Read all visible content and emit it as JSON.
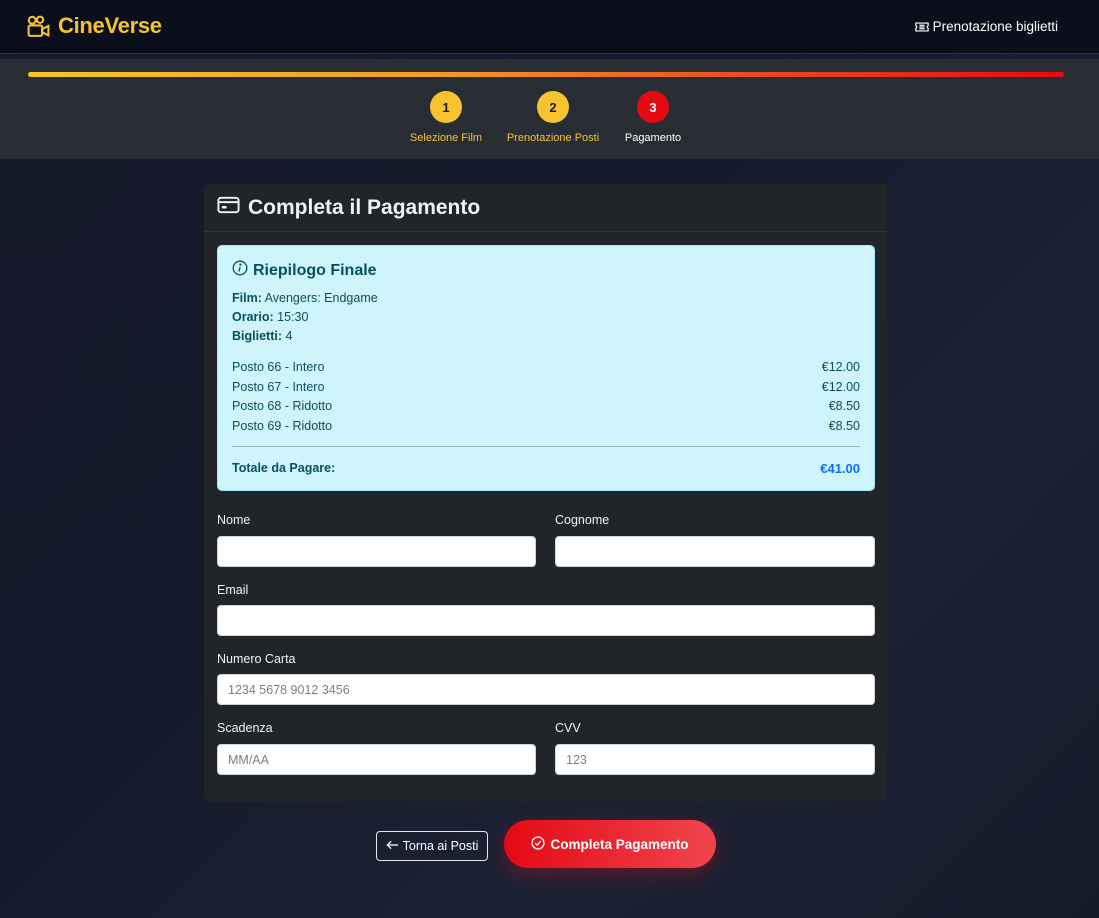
{
  "navbar": {
    "brand": "CineVerse",
    "link_label": "Prenotazione biglietti"
  },
  "stepper": {
    "steps": [
      {
        "number": "1",
        "label": "Selezione Film",
        "state": "done"
      },
      {
        "number": "2",
        "label": "Prenotazione Posti",
        "state": "done"
      },
      {
        "number": "3",
        "label": "Pagamento",
        "state": "active"
      }
    ]
  },
  "card": {
    "title": "Completa il Pagamento"
  },
  "summary": {
    "title": "Riepilogo Finale",
    "film_label": "Film:",
    "film_value": "Avengers: Endgame",
    "time_label": "Orario:",
    "time_value": "15:30",
    "tickets_label": "Biglietti:",
    "tickets_value": "4",
    "seats": [
      {
        "label": "Posto 66 - Intero",
        "price": "€12.00"
      },
      {
        "label": "Posto 67 - Intero",
        "price": "€12.00"
      },
      {
        "label": "Posto 68 - Ridotto",
        "price": "€8.50"
      },
      {
        "label": "Posto 69 - Ridotto",
        "price": "€8.50"
      }
    ],
    "total_label": "Totale da Pagare:",
    "total_value": "€41.00"
  },
  "form": {
    "first_name": {
      "label": "Nome",
      "value": "",
      "placeholder": ""
    },
    "last_name": {
      "label": "Cognome",
      "value": "",
      "placeholder": ""
    },
    "email": {
      "label": "Email",
      "value": "",
      "placeholder": ""
    },
    "card_number": {
      "label": "Numero Carta",
      "value": "",
      "placeholder": "1234 5678 9012 3456"
    },
    "expiry": {
      "label": "Scadenza",
      "value": "",
      "placeholder": "MM/AA"
    },
    "cvv": {
      "label": "CVV",
      "value": "",
      "placeholder": "123"
    }
  },
  "actions": {
    "back_label": "Torna ai Posti",
    "pay_label": "Completa Pagamento"
  },
  "colors": {
    "brand": "#f7c32e",
    "accent": "#e50914",
    "summary_bg": "#cff4fc",
    "total": "#0d6efd"
  }
}
